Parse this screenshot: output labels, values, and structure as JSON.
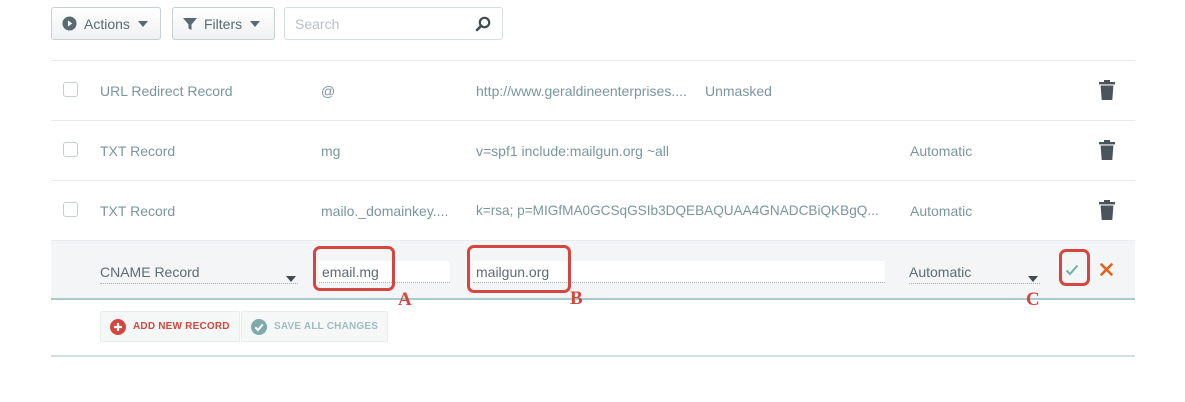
{
  "toolbar": {
    "actions_label": "Actions",
    "filters_label": "Filters",
    "search_placeholder": "Search"
  },
  "records": [
    {
      "type": "URL Redirect Record",
      "host": "@",
      "value": "http://www.geraldineenterprises....",
      "extra": "Unmasked",
      "ttl": ""
    },
    {
      "type": "TXT Record",
      "host": "mg",
      "value": "v=spf1 include:mailgun.org ~all",
      "extra": "",
      "ttl": "Automatic"
    },
    {
      "type": "TXT Record",
      "host": "mailo._domainkey....",
      "value": "k=rsa; p=MIGfMA0GCSqGSIb3DQEBAQUAA4GNADCBiQKBgQ...",
      "extra": "",
      "ttl": "Automatic"
    }
  ],
  "edit_row": {
    "type": "CNAME Record",
    "host": "email.mg",
    "value": "mailgun.org",
    "ttl": "Automatic"
  },
  "annotations": {
    "a": "A",
    "b": "B",
    "c": "C"
  },
  "footer": {
    "add_label": "ADD NEW RECORD",
    "save_label": "SAVE ALL CHANGES"
  },
  "colors": {
    "accent_red": "#d4463e",
    "confirm_green": "#6fb0a8",
    "cancel_orange": "#e2621b",
    "text_muted": "#7a969e"
  }
}
